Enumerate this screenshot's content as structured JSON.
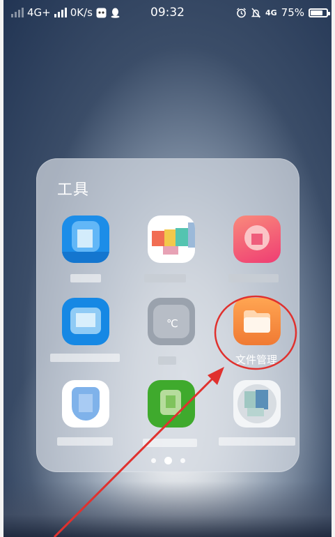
{
  "status_bar": {
    "network": "4G+",
    "speed": "0K/s",
    "time": "09:32",
    "network_right": "4G",
    "battery_percent": "75%",
    "battery_level": 0.75,
    "icons": [
      "signal-icon",
      "messenger-icon",
      "qq-icon",
      "alarm-icon",
      "mute-icon",
      "battery-icon"
    ]
  },
  "folder": {
    "title": "工具",
    "apps": [
      {
        "label": "",
        "icon": "app-blue-icon"
      },
      {
        "label": "",
        "icon": "app-colorful-icon"
      },
      {
        "label": "",
        "icon": "app-pink-icon"
      },
      {
        "label": "",
        "icon": "app-blue2-icon"
      },
      {
        "label": "℃",
        "icon": "weather-icon"
      },
      {
        "label": "文件管理",
        "icon": "file-manager-icon"
      },
      {
        "label": "",
        "icon": "app-shield-icon"
      },
      {
        "label": "",
        "icon": "app-green-icon"
      },
      {
        "label": "",
        "icon": "app-white-icon"
      }
    ],
    "pages": 3,
    "current_page": 2
  },
  "annotation": {
    "color": "#e0312e"
  }
}
